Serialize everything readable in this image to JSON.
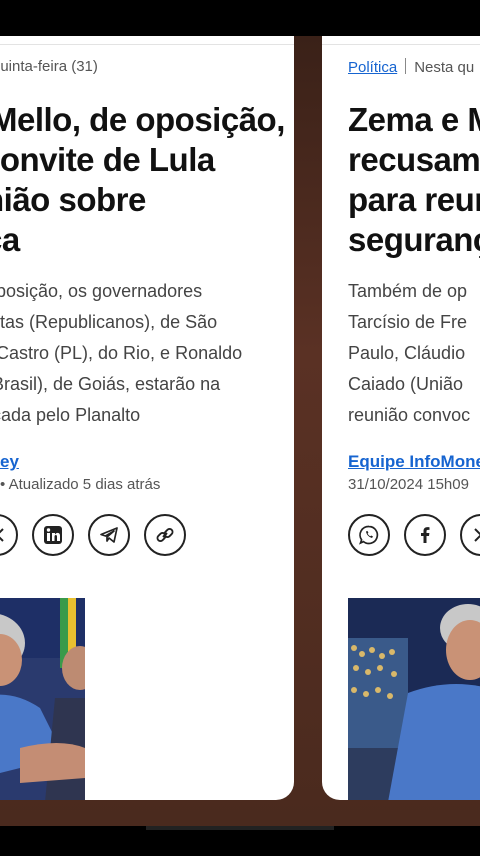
{
  "left_article": {
    "meta": "quinta-feira (31)",
    "title_lines": [
      "Mello, de oposição,",
      "convite de Lula",
      "nião sobre",
      "ça"
    ],
    "summary_lines": [
      "posição, os governadores",
      "itas (Republicanos), de São",
      "Castro (PL), do Rio, e Ronaldo",
      "Brasil), de Goiás, estarão na",
      "cada pelo Planalto"
    ],
    "author": "ey",
    "date": "• Atualizado 5 dias atrás",
    "share_icons": [
      "x-icon",
      "linkedin-icon",
      "telegram-icon",
      "link-icon"
    ]
  },
  "right_article": {
    "category": "Política",
    "meta": "Nesta qu",
    "title_lines": [
      "Zema e M",
      "recusam",
      "para reun",
      "seguranç"
    ],
    "summary_lines": [
      "Também de op",
      "Tarcísio de Fre",
      "Paulo, Cláudio",
      "Caiado (União",
      "reunião convoc"
    ],
    "author": "Equipe InfoMone",
    "date": "31/10/2024 15h09",
    "share_icons": [
      "whatsapp-icon",
      "facebook-icon",
      "x-icon"
    ]
  },
  "colors": {
    "accent": "#1664d0",
    "background": "#4a2a1e"
  }
}
